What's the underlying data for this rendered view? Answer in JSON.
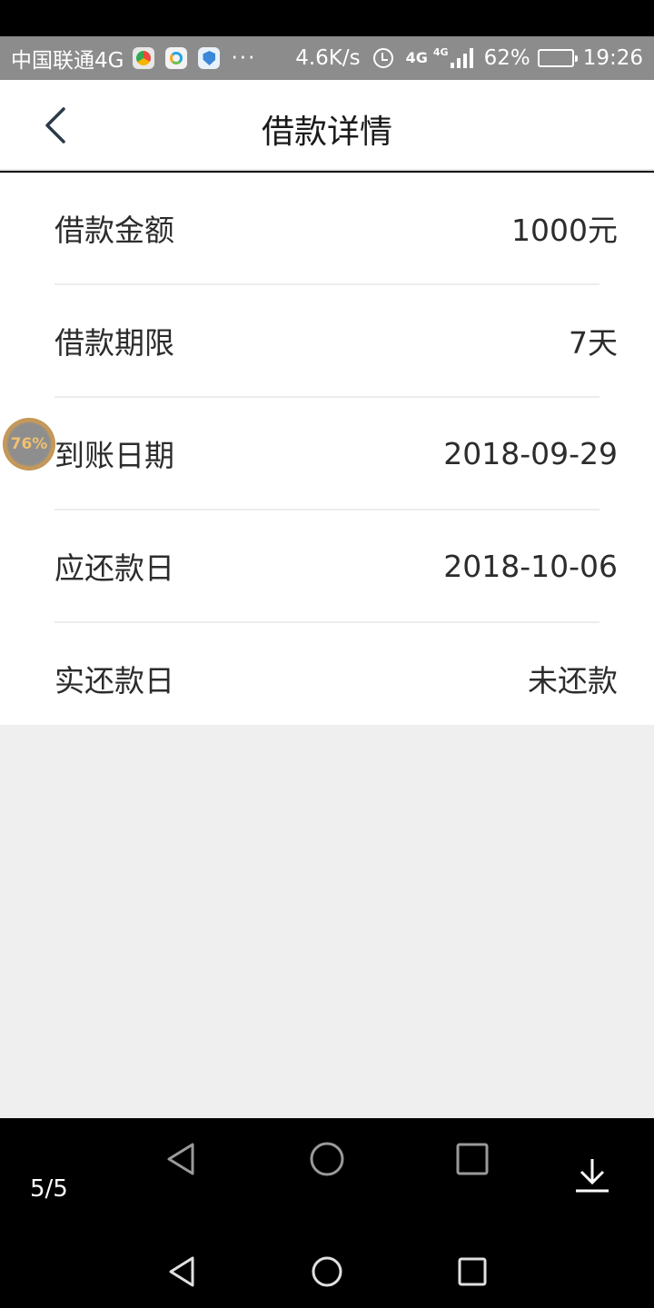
{
  "status_bar": {
    "carrier": "中国联通4G",
    "more": "···",
    "speed": "4.6K/s",
    "network": "4G",
    "network_small": "4G",
    "battery_percent": "62%",
    "battery_level": 0.62,
    "time": "19:26"
  },
  "header": {
    "title": "借款详情"
  },
  "details": [
    {
      "label": "借款金额",
      "value": "1000元"
    },
    {
      "label": "借款期限",
      "value": "7天"
    },
    {
      "label": "到账日期",
      "value": "2018-09-29"
    },
    {
      "label": "应还款日",
      "value": "2018-10-06"
    },
    {
      "label": "实还款日",
      "value": "未还款"
    }
  ],
  "floating_ball": {
    "percent": "76%"
  },
  "viewer": {
    "page_counter": "5/5"
  },
  "colors": {
    "status_bar_bg": "#8c8c8c",
    "content_bg": "#efefef",
    "text": "#2c2c2c"
  }
}
